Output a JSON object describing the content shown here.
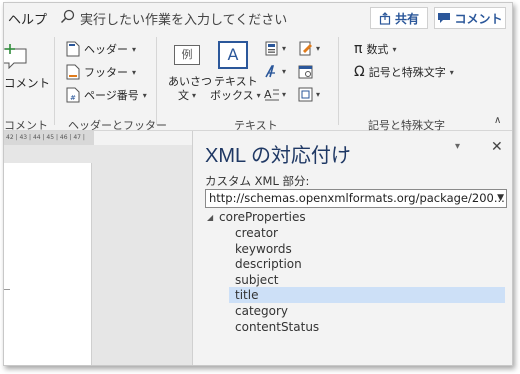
{
  "tabs": {
    "help": "ヘルプ"
  },
  "search": {
    "placeholder": "実行したい作業を入力してください"
  },
  "header_buttons": {
    "share": "共有",
    "comment": "コメント"
  },
  "ribbon": {
    "comments_group": {
      "button": "コメント",
      "label": "コメント"
    },
    "header_footer_group": {
      "label": "ヘッダーとフッター",
      "header": "ヘッダー",
      "footer": "フッター",
      "page_number": "ページ番号"
    },
    "text_group": {
      "label": "テキスト",
      "greeting_line1": "あいさつ",
      "greeting_line2": "文",
      "textbox_line1": "テキスト",
      "textbox_line2": "ボックス",
      "greeting_icon_text": "例",
      "textbox_icon_text": "A"
    },
    "symbols_group": {
      "label": "記号と特殊文字",
      "equation": "数式",
      "symbol": "記号と特殊文字"
    }
  },
  "ruler": {
    "text": "42 | 43 | 44 | 45 | 46 | 47 | 48"
  },
  "pane": {
    "title": "XML の対応付け",
    "custom_xml_label": "カスタム XML 部分:",
    "selected_url": "http://schemas.openxmlformats.org/package/200...",
    "tree": {
      "root": "coreProperties",
      "children": [
        "creator",
        "keywords",
        "description",
        "subject",
        "title",
        "category",
        "contentStatus"
      ],
      "selected_index": 4
    }
  },
  "colors": {
    "accent": "#2b579a",
    "selection": "#cde0f7",
    "pane_title": "#1f3864"
  }
}
